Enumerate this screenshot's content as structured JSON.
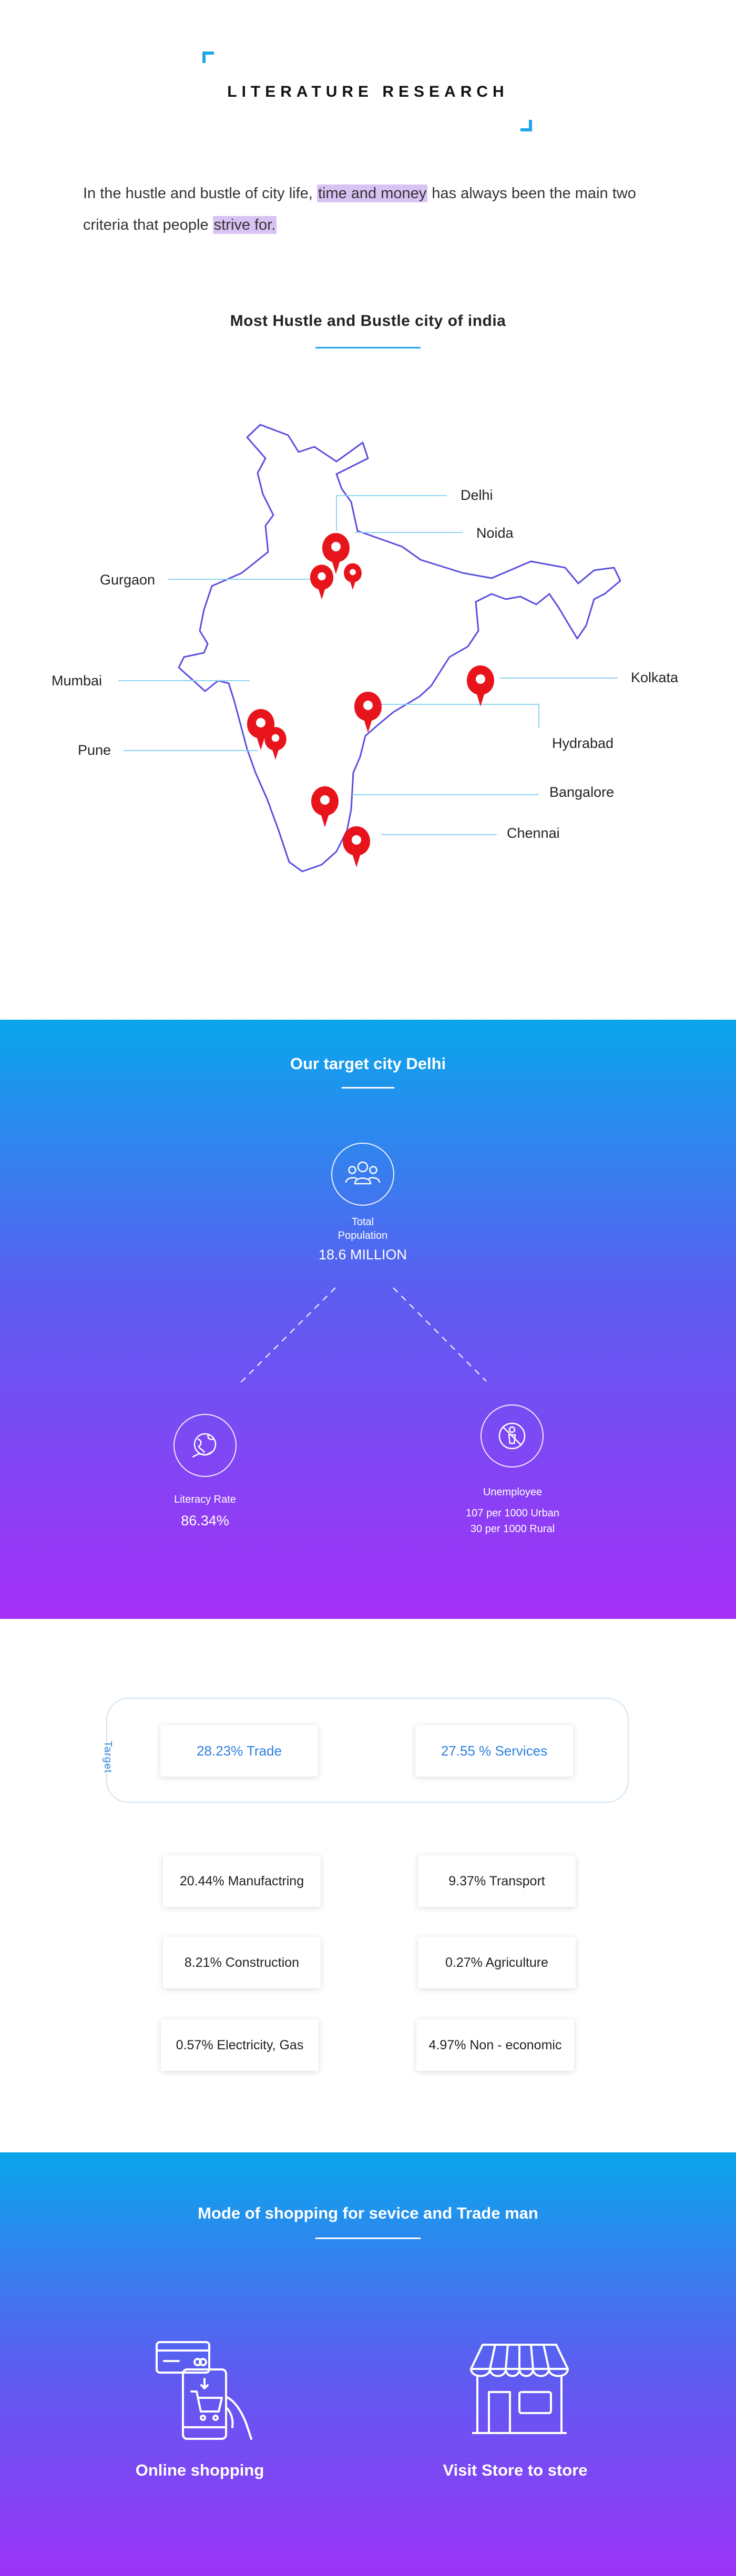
{
  "literature": {
    "title": "LITERATURE RESEARCH",
    "intro_part1": "In the hustle and bustle of city life, ",
    "intro_highlight1": "time and money",
    "intro_part2": " has always been the main two criteria that people ",
    "intro_highlight2": "strive for.",
    "accent_color": "#1ea6e8",
    "highlight_color": "#d9c3f4"
  },
  "map": {
    "title": "Most Hustle and Bustle city of india",
    "outline_color": "#5b4fe0",
    "pin_color": "#e8141c",
    "leader_color": "#8fd3f4",
    "cities": {
      "delhi": "Delhi",
      "noida": "Noida",
      "gurgaon": "Gurgaon",
      "mumbai": "Mumbai",
      "pune": "Pune",
      "kolkata": "Kolkata",
      "hydrabad": "Hydrabad",
      "bangalore": "Bangalore",
      "chennai": "Chennai"
    }
  },
  "target": {
    "title": "Our target city Delhi",
    "population_label_1": "Total",
    "population_label_2": "Population",
    "population_value": "18.6 MILLION",
    "literacy_label": "Literacy Rate",
    "literacy_value": "86.34%",
    "unemployee_label": "Unemployee",
    "unemployee_urban": "107 per 1000 Urban",
    "unemployee_rural": "30 per 1000 Rural",
    "icons": [
      "people-group-icon",
      "globe-hand-icon",
      "no-work-icon"
    ]
  },
  "sectors": {
    "target_tag": "Target",
    "trade": "28.23%  Trade",
    "services": "27.55 %  Services",
    "manufacturing": "20.44%  Manufactring",
    "transport": "9.37% Transport",
    "construction": "8.21% Construction",
    "agriculture": "0.27% Agriculture",
    "electricity": "0.57% Electricity, Gas",
    "non_economic": "4.97% Non - economic",
    "highlight_color": "#2f7fe0"
  },
  "shopping": {
    "title": "Mode of shopping for sevice and Trade man",
    "online": "Online shopping",
    "store": "Visit Store to store",
    "icons": [
      "online-shopping-icon",
      "store-icon"
    ]
  }
}
